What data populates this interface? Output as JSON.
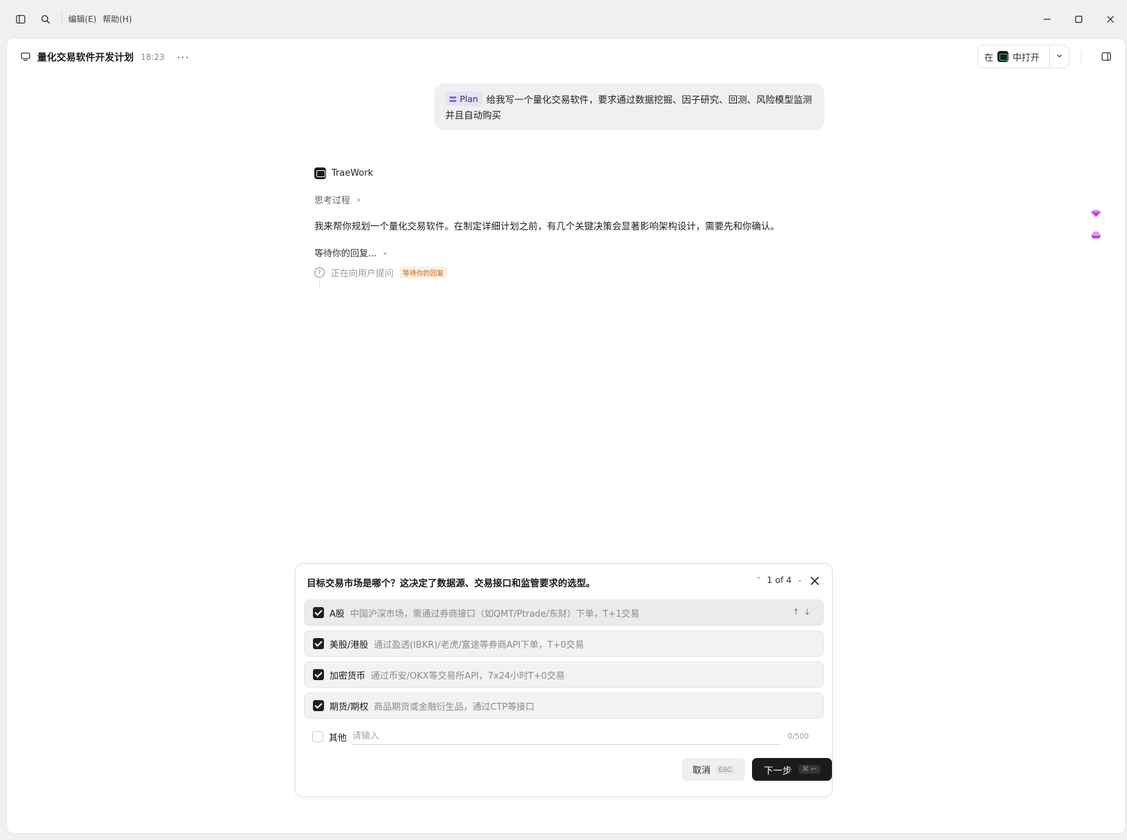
{
  "titlebar": {
    "menu_edit": "编辑(E)",
    "menu_help": "帮助(H)"
  },
  "header": {
    "title": "量化交易软件开发计划",
    "time": "18:23",
    "more": "···",
    "open_in_prefix": "在",
    "open_in_suffix": "中打开"
  },
  "user_message": {
    "tag": "Plan",
    "text": "给我写一个量化交易软件，要求通过数据挖掘、因子研究、回测、风险模型监测并且自动购买"
  },
  "assistant": {
    "name": "TraeWork",
    "thinking_label": "思考过程",
    "reply": "我来帮你规划一个量化交易软件。在制定详细计划之前，有几个关键决策会显著影响架构设计，需要先和你确认。",
    "waiting_label": "等待你的回复...",
    "asking_label": "正在向用户提问",
    "asking_badge": "等待你的回复"
  },
  "question": {
    "title": "目标交易市场是哪个？这决定了数据源、交易接口和监管要求的选型。",
    "pager": "1 of 4",
    "options": [
      {
        "label": "A股",
        "desc": "中国沪深市场，需通过券商接口（如QMT/Ptrade/东财）下单，T+1交易",
        "checked": true
      },
      {
        "label": "美股/港股",
        "desc": "通过盈透(IBKR)/老虎/富途等券商API下单，T+0交易",
        "checked": true
      },
      {
        "label": "加密货币",
        "desc": "通过币安/OKX等交易所API，7x24小时T+0交易",
        "checked": true
      },
      {
        "label": "期货/期权",
        "desc": "商品期货或金融衍生品，通过CTP等接口",
        "checked": true
      }
    ],
    "other_label": "其他",
    "other_placeholder": "请输入",
    "other_counter": "0/500",
    "cancel_label": "取消",
    "cancel_kbd": "ESC",
    "next_label": "下一步",
    "next_kbd": "⌘ ↩"
  },
  "colors": {
    "accent_dark": "#1b1b1b",
    "badge_orange": "#c26a13",
    "plan_tag_bg": "#e5e4f3",
    "gem_purple": "#c93ce6"
  }
}
